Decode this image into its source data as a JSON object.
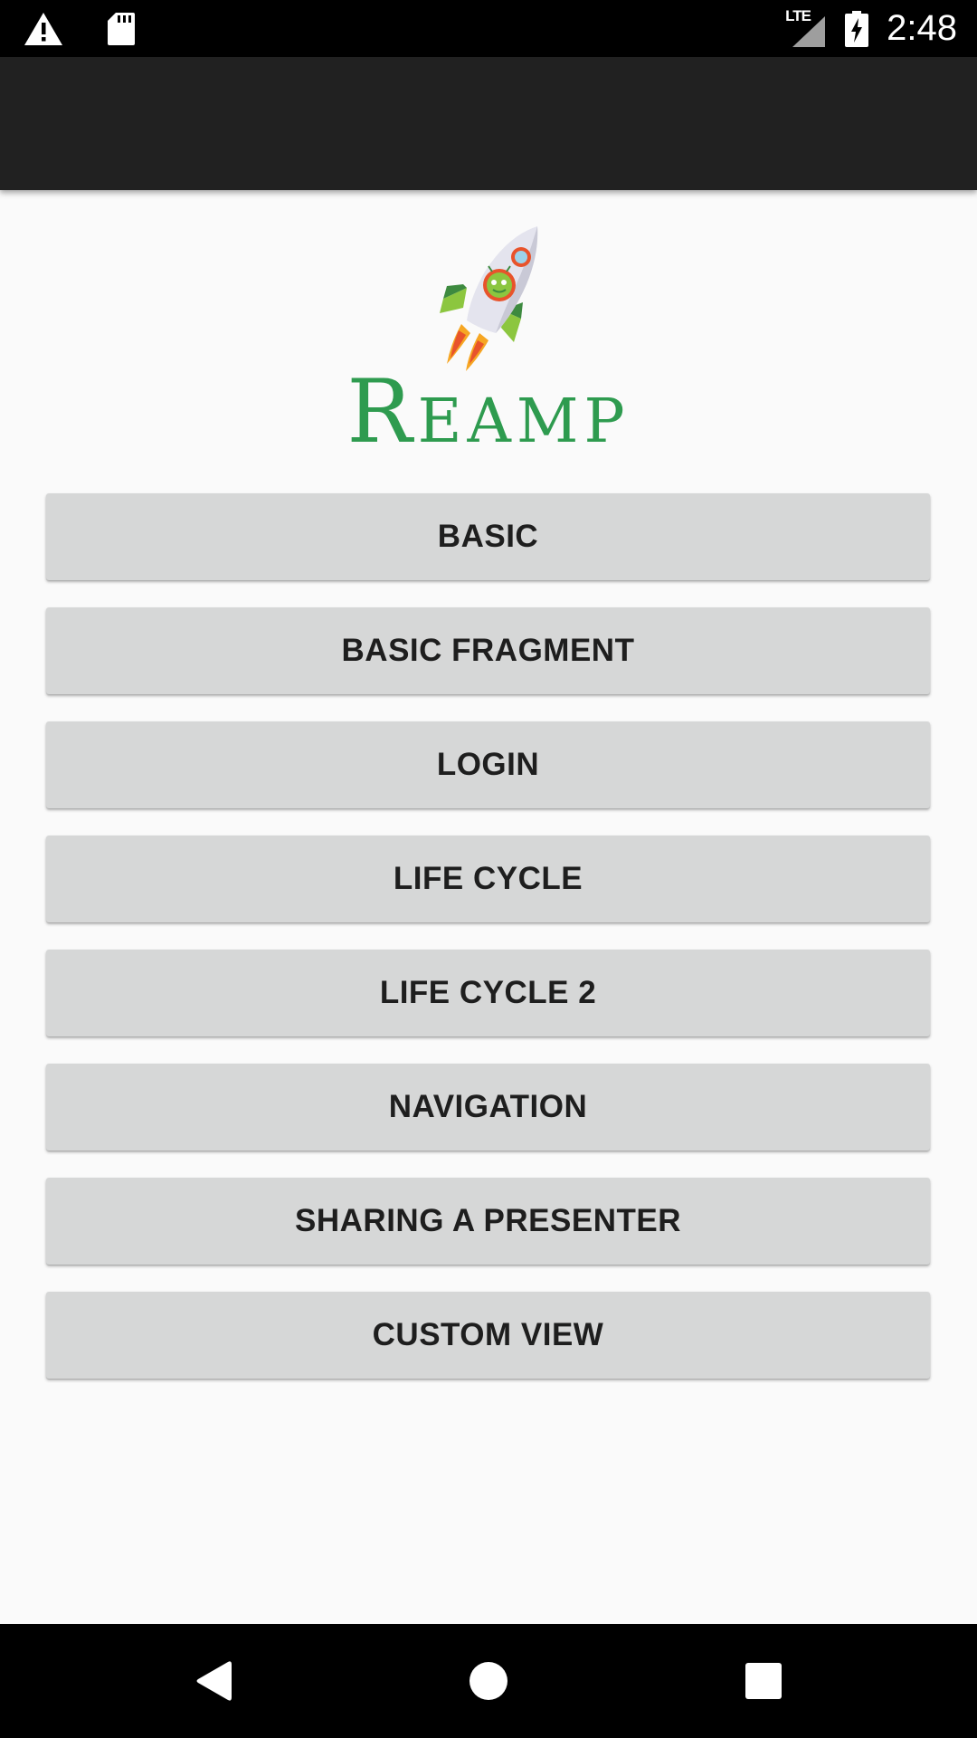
{
  "status_bar": {
    "time": "2:48",
    "network": "LTE",
    "icons": [
      "alert-icon",
      "sd-card-icon",
      "lte-signal-icon",
      "battery-charging-icon"
    ]
  },
  "app_bar": {
    "title": ""
  },
  "logo": {
    "wordmark": "Reamp",
    "icon": "rocket-logo-icon",
    "color": "#2e9b4f"
  },
  "menu": {
    "buttons": [
      {
        "label": "BASIC"
      },
      {
        "label": "BASIC FRAGMENT"
      },
      {
        "label": "LOGIN"
      },
      {
        "label": "LIFE CYCLE"
      },
      {
        "label": "LIFE CYCLE 2"
      },
      {
        "label": "NAVIGATION"
      },
      {
        "label": "SHARING A PRESENTER"
      },
      {
        "label": "CUSTOM VIEW"
      }
    ]
  },
  "nav_bar": {
    "icons": [
      "back-icon",
      "home-icon",
      "recents-icon"
    ]
  },
  "colors": {
    "status_bar": "#000000",
    "app_bar": "#212121",
    "background": "#fafafa",
    "button": "#d6d7d7",
    "button_text": "#1e1e1e",
    "brand_green": "#2e9b4f"
  }
}
